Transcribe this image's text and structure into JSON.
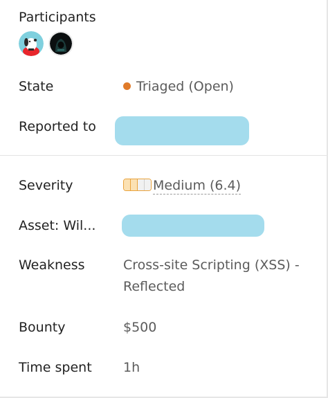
{
  "participants": {
    "title": "Participants",
    "avatars": [
      {
        "name": "participant-avatar-1",
        "icon": "cartoon-dog-avatar"
      },
      {
        "name": "participant-avatar-2",
        "icon": "hooded-figure-avatar"
      }
    ]
  },
  "state": {
    "label": "State",
    "value": "Triaged (Open)",
    "dot_color": "#e07b2a"
  },
  "reported_to": {
    "label": "Reported to"
  },
  "severity": {
    "label": "Severity",
    "value": "Medium (6.4)",
    "meter_level": 2,
    "meter_max": 4
  },
  "asset": {
    "label": "Asset: Wil..."
  },
  "weakness": {
    "label": "Weakness",
    "value": "Cross-site Scripting (XSS) - Reflected"
  },
  "bounty": {
    "label": "Bounty",
    "value": "$500"
  },
  "time_spent": {
    "label": "Time spent",
    "value": "1h"
  },
  "colors": {
    "redaction": "#a4dced",
    "severity": "#e9a23b"
  }
}
